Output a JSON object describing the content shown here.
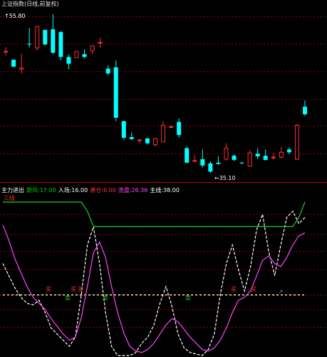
{
  "topbar": {
    "text": "上证指数(日线,前复权)"
  },
  "upper": {
    "high_label": "↑55.80",
    "low_label": "←35.10"
  },
  "lower": {
    "legend": [
      {
        "text": "主力进出",
        "color": "#ffffff"
      },
      {
        "text": "跟风:17.00",
        "color": "#00cc00"
      },
      {
        "text": "入场:16.00",
        "color": "#ffffff"
      },
      {
        "text": "建仓:6.00",
        "color": "#ff3030"
      },
      {
        "text": "洗盘:26.36",
        "color": "#ff44ff"
      },
      {
        "text": "主线:38.00",
        "color": "#ffffff"
      }
    ],
    "corner_label": "三线"
  },
  "colors": {
    "up": "#ff3030",
    "down": "#00ffff",
    "white": "#ffffff",
    "magenta": "#ff44ff",
    "green": "#22cc22",
    "grid": "#990000"
  },
  "chart_data": [
    {
      "type": "candlestick",
      "title": "",
      "ylim": [
        33,
        58
      ],
      "candles": [
        {
          "o": 51.6,
          "h": 52.2,
          "c": 51.6,
          "l": 51.0
        },
        {
          "o": 50.4,
          "h": 50.4,
          "c": 49.4,
          "l": 49.3
        },
        {
          "o": 49.0,
          "h": 51.2,
          "c": 49.2,
          "l": 48.4
        },
        {
          "o": 52.7,
          "h": 55.0,
          "c": 52.6,
          "l": 52.2
        },
        {
          "o": 52.1,
          "h": 55.0,
          "c": 55.2,
          "l": 51.7
        },
        {
          "o": 54.7,
          "h": 54.8,
          "c": 52.6,
          "l": 52.5
        },
        {
          "o": 54.8,
          "h": 57.0,
          "c": 51.4,
          "l": 51.2
        },
        {
          "o": 54.4,
          "h": 54.6,
          "c": 50.8,
          "l": 50.3
        },
        {
          "o": 50.8,
          "h": 51.1,
          "c": 49.8,
          "l": 49.0
        },
        {
          "o": 50.7,
          "h": 51.5,
          "c": 51.6,
          "l": 50.7
        },
        {
          "o": 51.2,
          "h": 51.9,
          "c": 50.8,
          "l": 50.6
        },
        {
          "o": 51.7,
          "h": 52.0,
          "c": 52.4,
          "l": 51.2
        },
        {
          "o": 52.9,
          "h": 53.6,
          "c": 52.9,
          "l": 52.1
        },
        {
          "o": 49.1,
          "h": 49.6,
          "c": 48.4,
          "l": 48.2
        },
        {
          "o": 49.3,
          "h": 50.3,
          "c": 42.0,
          "l": 41.5
        },
        {
          "o": 41.5,
          "h": 41.6,
          "c": 39.1,
          "l": 38.8
        },
        {
          "o": 39.2,
          "h": 39.9,
          "c": 38.9,
          "l": 38.8
        },
        {
          "o": 38.8,
          "h": 38.9,
          "c": 38.8,
          "l": 38.3
        },
        {
          "o": 39.0,
          "h": 39.1,
          "c": 38.3,
          "l": 38.1
        },
        {
          "o": 38.1,
          "h": 38.9,
          "c": 39.0,
          "l": 37.8
        },
        {
          "o": 38.5,
          "h": 41.5,
          "c": 40.9,
          "l": 38.5
        },
        {
          "o": 40.6,
          "h": 40.9,
          "c": 40.7,
          "l": 40.5
        },
        {
          "o": 41.4,
          "h": 41.9,
          "c": 39.5,
          "l": 39.1
        },
        {
          "o": 37.6,
          "h": 37.9,
          "c": 35.5,
          "l": 35.4
        },
        {
          "o": 35.8,
          "h": 36.6,
          "c": 35.8,
          "l": 35.6
        },
        {
          "o": 36.0,
          "h": 37.4,
          "c": 35.1,
          "l": 34.8
        },
        {
          "o": 35.4,
          "h": 35.7,
          "c": 34.2,
          "l": 34.0
        },
        {
          "o": 35.5,
          "h": 36.4,
          "c": 35.3,
          "l": 35.2
        },
        {
          "o": 36.0,
          "h": 38.3,
          "c": 37.6,
          "l": 35.8
        },
        {
          "o": 36.5,
          "h": 36.7,
          "c": 35.9,
          "l": 35.7
        },
        {
          "o": 35.5,
          "h": 35.6,
          "c": 35.4,
          "l": 35.3
        },
        {
          "o": 35.0,
          "h": 37.3,
          "c": 36.9,
          "l": 34.9
        },
        {
          "o": 36.8,
          "h": 37.6,
          "c": 36.4,
          "l": 36.0
        },
        {
          "o": 36.5,
          "h": 37.4,
          "c": 35.9,
          "l": 35.8
        },
        {
          "o": 36.3,
          "h": 36.9,
          "c": 36.3,
          "l": 36.0
        },
        {
          "o": 36.3,
          "h": 37.8,
          "c": 37.0,
          "l": 36.1
        },
        {
          "o": 37.4,
          "h": 37.7,
          "c": 37.0,
          "l": 36.7
        },
        {
          "o": 36.0,
          "h": 41.1,
          "c": 40.9,
          "l": 35.9
        },
        {
          "o": 43.6,
          "h": 44.5,
          "c": 42.5,
          "l": 42.3
        }
      ]
    },
    {
      "type": "line",
      "title": "",
      "series": [
        {
          "color": "#ffffff",
          "dashed": true,
          "values": [
            60,
            52,
            44,
            38,
            34,
            33,
            36,
            28,
            18,
            14,
            10,
            6,
            12,
            40,
            72,
            84,
            60,
            28,
            6,
            0,
            0,
            0,
            2,
            8,
            12,
            20,
            34,
            45,
            32,
            14,
            5,
            2,
            1,
            0,
            4,
            14,
            40,
            60,
            72,
            56,
            42,
            58,
            82,
            92,
            68,
            52,
            72,
            90,
            94,
            86,
            90
          ]
        },
        {
          "color": "#ff44ff",
          "dashed": false,
          "values": [
            85,
            75,
            63,
            54,
            45,
            38,
            34,
            30,
            24,
            19,
            14,
            10,
            12,
            25,
            45,
            67,
            74,
            64,
            45,
            28,
            15,
            6,
            3,
            2,
            4,
            8,
            14,
            20,
            24,
            22,
            17,
            12,
            8,
            4,
            3,
            5,
            10,
            18,
            28,
            36,
            38,
            42,
            52,
            62,
            65,
            60,
            58,
            64,
            72,
            78,
            80
          ]
        },
        {
          "color": "#22cc22",
          "dashed": false,
          "values": [
            100,
            100,
            100,
            100,
            100,
            100,
            100,
            100,
            100,
            100,
            100,
            100,
            100,
            100,
            94,
            84,
            84,
            84,
            84,
            84,
            84,
            84,
            84,
            84,
            84,
            84,
            84,
            84,
            84,
            84,
            84,
            84,
            84,
            84,
            84,
            84,
            84,
            84,
            84,
            84,
            84,
            84,
            84,
            84,
            84,
            84,
            84,
            84,
            84,
            90,
            100
          ]
        }
      ]
    }
  ]
}
